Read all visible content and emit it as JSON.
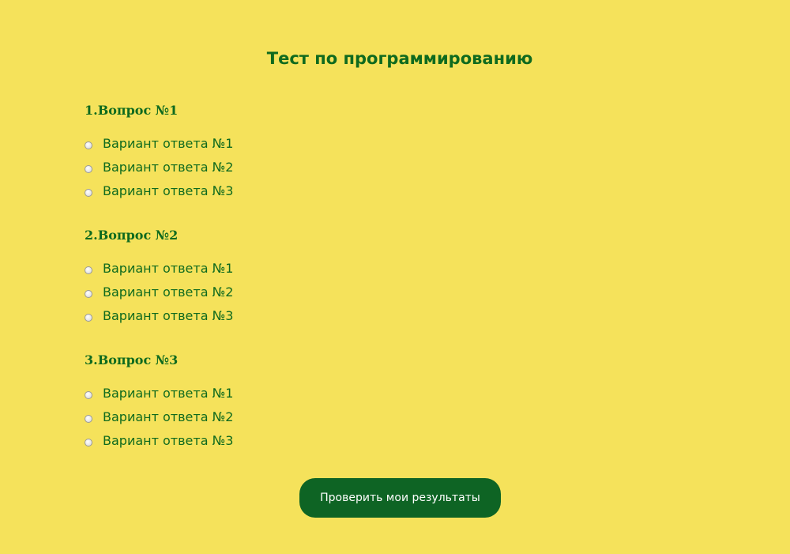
{
  "page": {
    "title": "Тест по программированию"
  },
  "questions": [
    {
      "title": "1.Вопрос №1",
      "answers": [
        "Вариант ответа №1",
        "Вариант ответа №2",
        "Вариант ответа №3"
      ]
    },
    {
      "title": "2.Вопрос №2",
      "answers": [
        "Вариант ответа №1",
        "Вариант ответа №2",
        "Вариант ответа №3"
      ]
    },
    {
      "title": "3.Вопрос №3",
      "answers": [
        "Вариант ответа №1",
        "Вариант ответа №2",
        "Вариант ответа №3"
      ]
    }
  ],
  "submit": {
    "label": "Проверить мои результаты"
  },
  "colors": {
    "background": "#f5e25b",
    "text": "#0f6a1e",
    "button": "#0e6424",
    "button_text": "#ffffff"
  }
}
